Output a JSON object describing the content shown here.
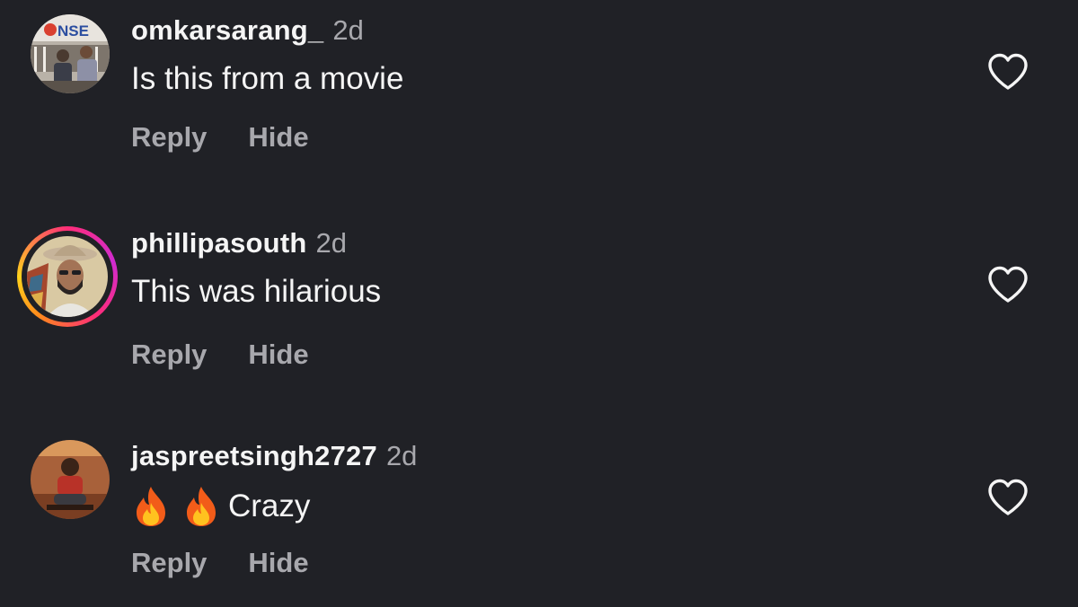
{
  "comments": [
    {
      "username": "omkarsarang_",
      "time": "2d",
      "text": "Is this from a movie",
      "emojis": [],
      "avatar_label": "NSE",
      "has_story_ring": false,
      "actions": {
        "reply": "Reply",
        "hide": "Hide"
      },
      "like_icon": "heart-outline-icon"
    },
    {
      "username": "phillipasouth",
      "time": "2d",
      "text": "This was hilarious",
      "emojis": [],
      "has_story_ring": true,
      "actions": {
        "reply": "Reply",
        "hide": "Hide"
      },
      "like_icon": "heart-outline-icon"
    },
    {
      "username": "jaspreetsingh2727",
      "time": "2d",
      "text": "Crazy",
      "emojis": [
        "fire-emoji",
        "fire-emoji"
      ],
      "has_story_ring": false,
      "actions": {
        "reply": "Reply",
        "hide": "Hide"
      },
      "like_icon": "heart-outline-icon"
    }
  ],
  "colors": {
    "background": "#202126",
    "primary_text": "#f5f5f5",
    "secondary_text": "#a8a8ad",
    "story_ring_start": "#ff2d78",
    "story_ring_end": "#ffd31c"
  }
}
